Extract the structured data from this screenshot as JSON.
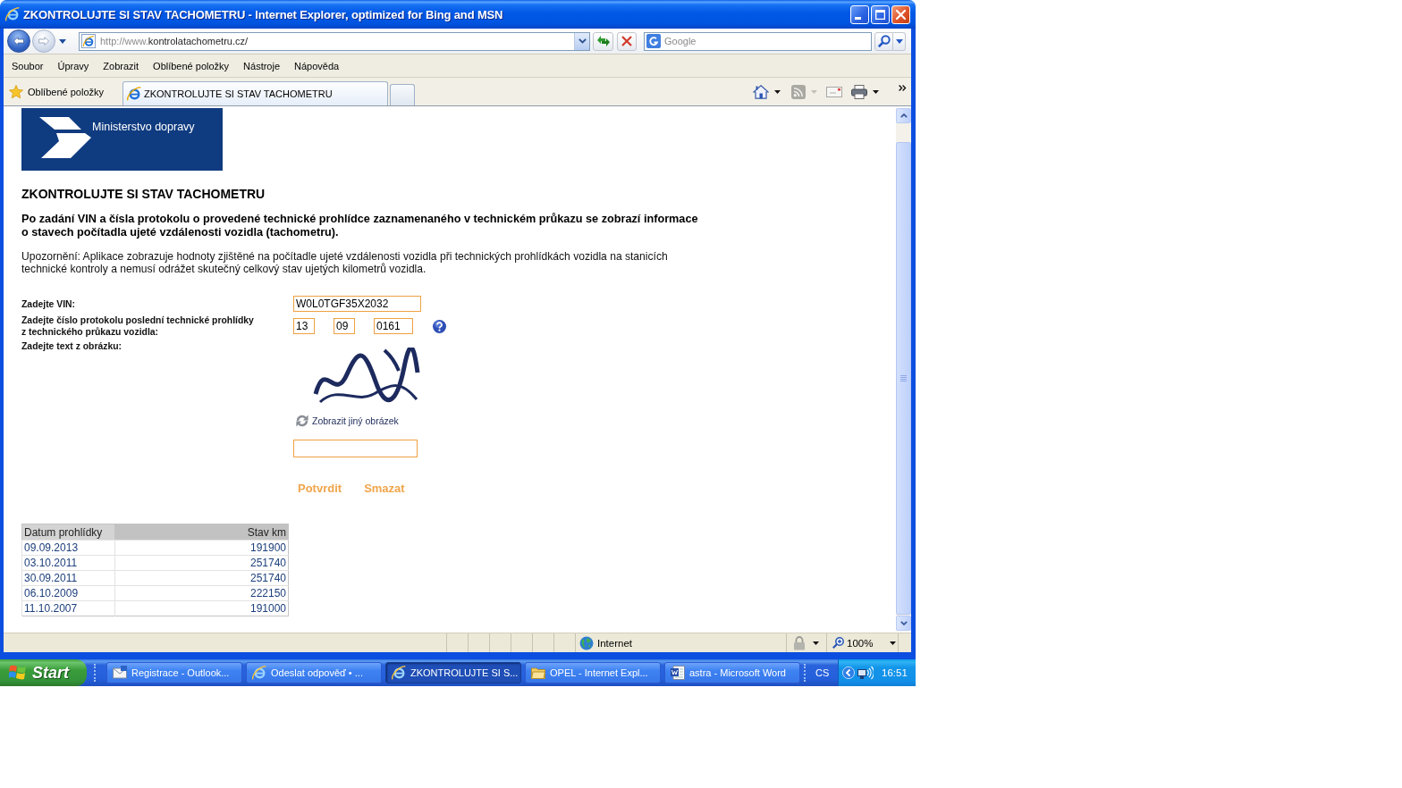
{
  "window": {
    "title": "ZKONTROLUJTE SI STAV TACHOMETRU - Internet Explorer, optimized for Bing and MSN"
  },
  "navigation_bar": {
    "address": {
      "prefix": "http://www.",
      "host": "kontrolatachometru.cz/"
    },
    "search": {
      "placeholder": "Google"
    }
  },
  "menu_bar": [
    "Soubor",
    "Úpravy",
    "Zobrazit",
    "Oblíbené položky",
    "Nástroje",
    "Nápověda"
  ],
  "favorites_bar": {
    "favorites_label": "Oblíbené položky",
    "tabs": [
      {
        "label": "ZKONTROLUJTE SI STAV TACHOMETRU",
        "selected": true
      }
    ]
  },
  "page": {
    "logo_text": "Ministerstvo dopravy",
    "heading": "ZKONTROLUJTE SI STAV TACHOMETRU",
    "intro_lines": [
      "Po zadání VIN a čísla protokolu o provedené technické prohlídce zaznamenaného v technickém průkazu se zobrazí informace",
      "o stavech počítadla ujeté vzdálenosti vozidla (tachometru)."
    ],
    "notice_lines": [
      "Upozornění: Aplikace zobrazuje hodnoty zjištěné na počítadle ujeté vzdálenosti vozidla při technických prohlídkách vozidla na stanicích",
      "technické kontroly a nemusí odrážet skutečný celkový stav ujetých kilometrů vozidla."
    ],
    "form": {
      "fields": [
        {
          "kind": "vin",
          "label_lines": [
            "Zadejte VIN:"
          ],
          "values": [
            "W0L0TGF35X2032"
          ]
        },
        {
          "kind": "protocol",
          "label_lines": [
            "Zadejte číslo protokolu poslední technické prohlídky",
            "z technického průkazu vozidla:"
          ],
          "values": [
            "13",
            "09",
            "0161"
          ]
        },
        {
          "kind": "captcha",
          "label_lines": [
            "Zadejte text z obrázku:"
          ],
          "refresh_link": "Zobrazit jiný obrázek"
        }
      ],
      "buttons": [
        "Potvrdit",
        "Smazat"
      ]
    },
    "table": {
      "columns": [
        "Datum prohlídky",
        "Stav km"
      ],
      "rows": [
        [
          "09.09.2013",
          "191900"
        ],
        [
          "03.10.2011",
          "251740"
        ],
        [
          "30.09.2011",
          "251740"
        ],
        [
          "06.10.2009",
          "222150"
        ],
        [
          "11.10.2007",
          "191000"
        ]
      ]
    }
  },
  "status_bar": {
    "zone": "Internet",
    "zoom": "100%"
  },
  "taskbar": {
    "start_label": "Start",
    "tasks": [
      {
        "kind": "mail",
        "label": "Registrace - Outlook...",
        "selected": false
      },
      {
        "kind": "browser",
        "label": "Odeslat odpověď • ...",
        "selected": false
      },
      {
        "kind": "browser",
        "label": "ZKONTROLUJTE SI S...",
        "selected": true
      },
      {
        "kind": "folder",
        "label": "OPEL - Internet Expl...",
        "selected": false
      },
      {
        "kind": "document",
        "label": "astra - Microsoft Word",
        "selected": false
      }
    ],
    "language": "CS",
    "clock": "16:51"
  }
}
